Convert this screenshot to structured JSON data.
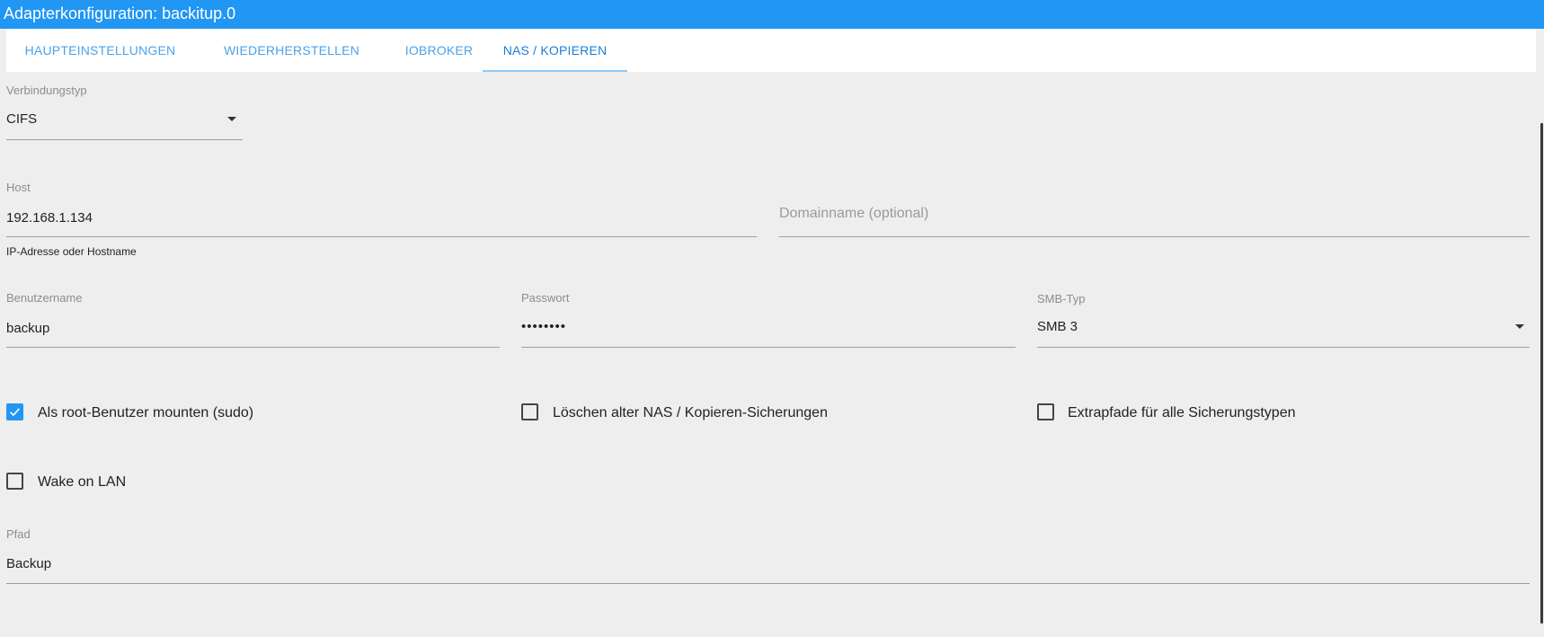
{
  "window": {
    "title": "Adapterkonfiguration: backitup.0"
  },
  "tabs": [
    {
      "label": "HAUPTEINSTELLUNGEN"
    },
    {
      "label": "WIEDERHERSTELLEN"
    },
    {
      "label": "IOBROKER"
    },
    {
      "label": "NAS / KOPIEREN"
    }
  ],
  "active_tab": "NAS / KOPIEREN",
  "connection": {
    "label": "Verbindungstyp",
    "value": "CIFS"
  },
  "host": {
    "label": "Host",
    "value": "192.168.1.134",
    "helper": "IP-Adresse oder Hostname"
  },
  "domain": {
    "placeholder": "Domainname (optional)"
  },
  "username": {
    "label": "Benutzername",
    "value": "backup"
  },
  "password": {
    "label": "Passwort",
    "value": "••••••••"
  },
  "smb": {
    "label": "SMB-Typ",
    "value": "SMB 3"
  },
  "checkboxes": {
    "sudo": {
      "label": "Als root-Benutzer mounten (sudo)",
      "checked": true
    },
    "delete_old": {
      "label": "Löschen alter NAS / Kopieren-Sicherungen",
      "checked": false
    },
    "extra_paths": {
      "label": "Extrapfade für alle Sicherungstypen",
      "checked": false
    },
    "wol": {
      "label": "Wake on LAN",
      "checked": false
    }
  },
  "path": {
    "label": "Pfad",
    "value": "Backup"
  },
  "colors": {
    "accent": "#2196f3",
    "tab_text": "#4aa2e9",
    "background": "#eeeeee"
  }
}
